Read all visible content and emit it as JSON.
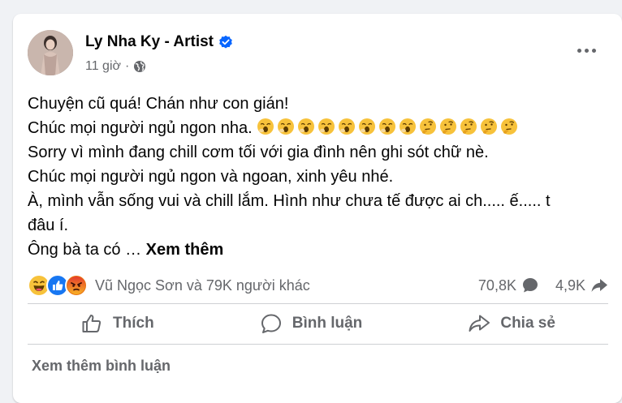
{
  "post": {
    "author": "Ly Nha Ky - Artist",
    "time": "11 giờ",
    "separator": "·",
    "lines": [
      "Chuyện cũ quá! Chán như con gián!",
      "Chúc mọi người ngủ ngon nha.",
      "Sorry vì mình đang chill cơm tối với gia đình nên ghi sót chữ nè.",
      "Chúc mọi người ngủ ngon và ngoan, xinh yêu nhé.",
      "À, mình vẫn sống vui và chill lắm. Hình như chưa tế được ai ch..... ế..... t",
      "đâu í.",
      "Ông bà ta có …"
    ],
    "emoji_line_icons": [
      "yawning-face",
      "yawning-face",
      "yawning-face",
      "yawning-face",
      "yawning-face",
      "yawning-face",
      "yawning-face",
      "yawning-face",
      "thinking-face",
      "thinking-face",
      "thinking-face",
      "thinking-face",
      "thinking-face"
    ],
    "see_more": "Xem thêm"
  },
  "reactions": {
    "icons": [
      "haha-icon",
      "like-icon",
      "angry-icon"
    ],
    "names": "Vũ Ngọc Sơn và 79K người khác",
    "comments": "70,8K",
    "shares": "4,9K"
  },
  "actions": {
    "like": "Thích",
    "comment": "Bình luận",
    "share": "Chia sẻ"
  },
  "view_more_comments": "Xem thêm bình luận",
  "colors": {
    "verified": "#0866ff",
    "like_blue": "#1877f2",
    "secondary_text": "#65676b",
    "emoji_yellow": "#f7c23b"
  }
}
